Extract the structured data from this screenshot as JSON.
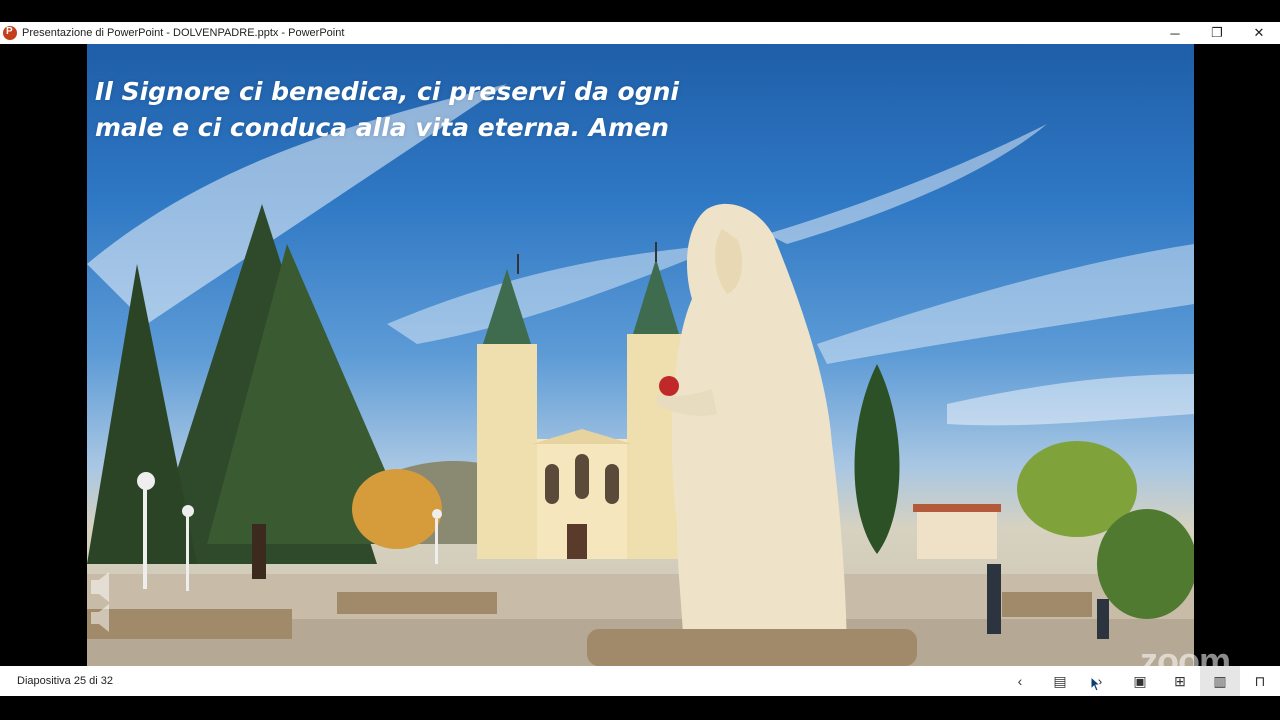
{
  "window": {
    "title": "Presentazione di PowerPoint  -  DOLVENPADRE.pptx - PowerPoint",
    "minimize_icon": "─",
    "restore_icon": "❐",
    "close_icon": "✕"
  },
  "slide": {
    "text_line1": "Il Signore ci benedica, ci preservi da ogni",
    "text_line2": "male e ci conduca alla vita eterna. Amen"
  },
  "status": {
    "slide_counter": "Diapositiva 25 di 32",
    "watermark": "zoom"
  },
  "nav": {
    "prev_icon": "‹",
    "notes_icon": "▤",
    "next_icon": "›",
    "normal_view_icon": "▣",
    "sorter_icon": "⊞",
    "reading_icon": "▥",
    "slideshow_icon": "⊓"
  },
  "colors": {
    "sky_top": "#1f5ea8",
    "ppt_icon": "#c43e1c"
  }
}
